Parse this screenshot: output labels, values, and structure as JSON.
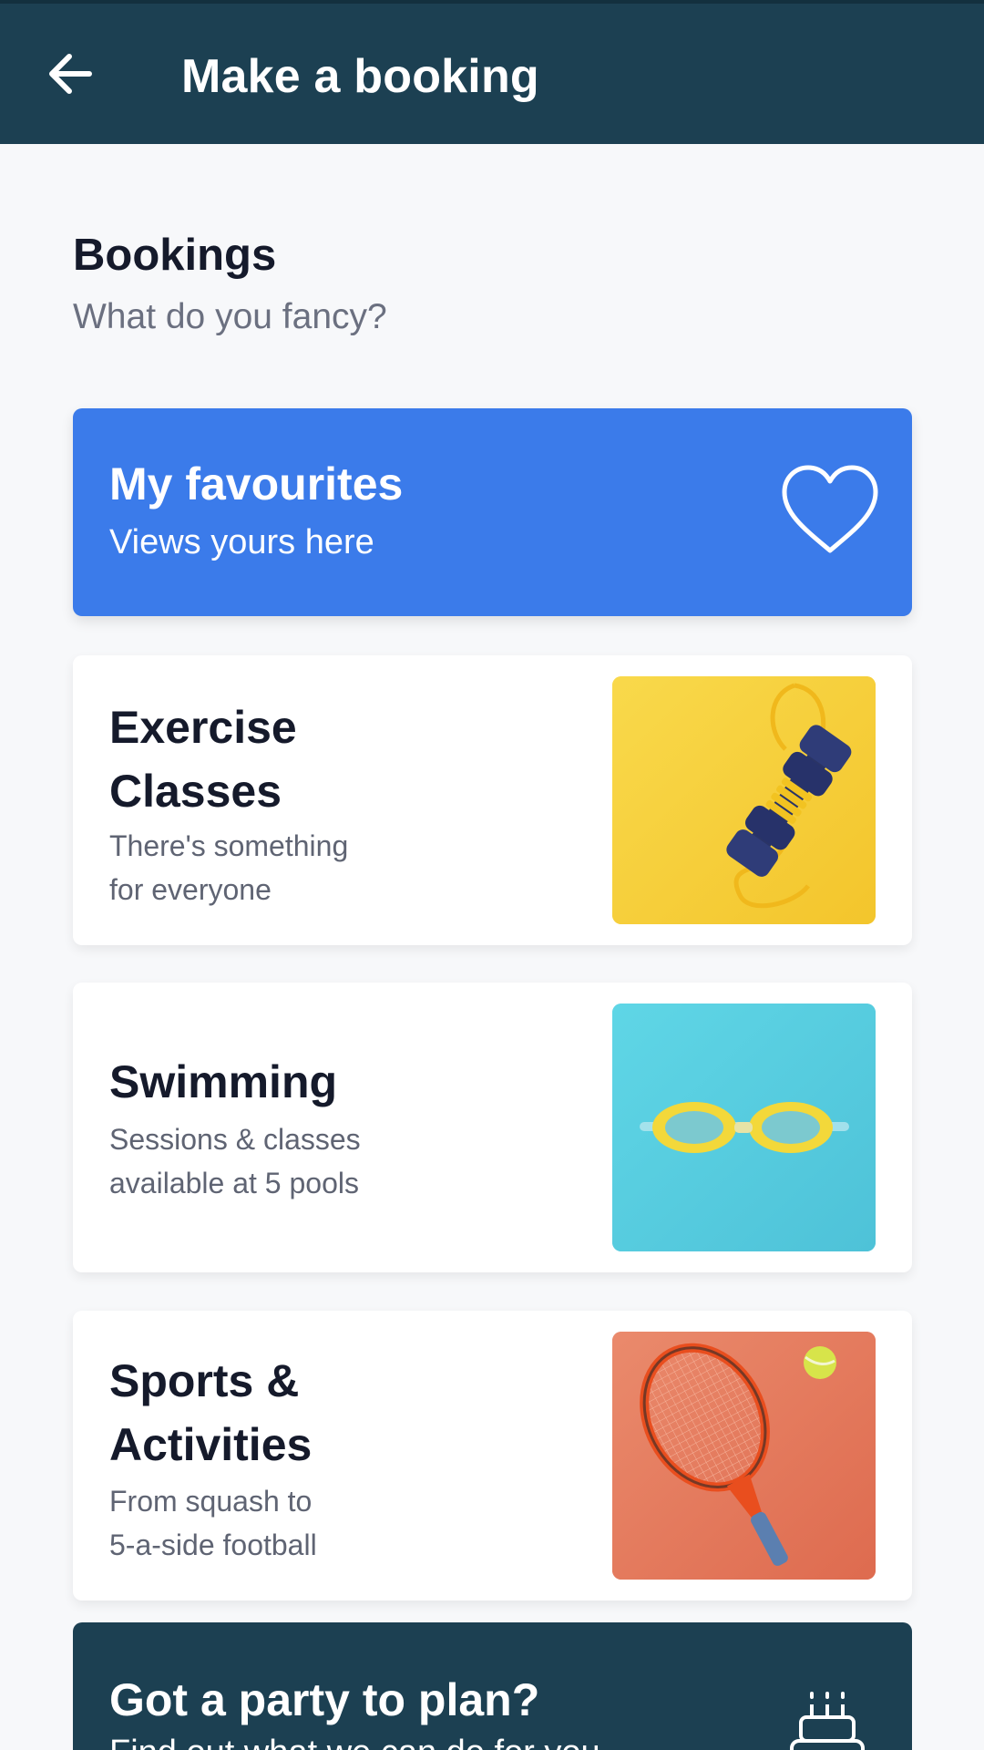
{
  "appbar": {
    "title": "Make a booking",
    "back_icon": "arrow-left-icon"
  },
  "section": {
    "title": "Bookings",
    "subtitle": "What do you fancy?"
  },
  "favourites": {
    "title": "My favourites",
    "subtitle": "Views yours here",
    "icon": "heart-icon",
    "color": "#3b7bea"
  },
  "cards": [
    {
      "title_line1": "Exercise",
      "title_line2": "Classes",
      "sub_line1": "There's something",
      "sub_line2": "for everyone",
      "image": "dumbbells-image",
      "image_bg": "#f7cf3d"
    },
    {
      "title_line1": "Swimming",
      "sub_line1": "Sessions & classes",
      "sub_line2": "available at 5 pools",
      "image": "swim-goggles-image",
      "image_bg": "#55c9de"
    },
    {
      "title_line1": "Sports &",
      "title_line2": "Activities",
      "sub_line1": "From squash to",
      "sub_line2": "5-a-side football",
      "image": "tennis-racket-image",
      "image_bg": "#e57a5e"
    }
  ],
  "party": {
    "title": "Got a party to plan?",
    "subtitle": "Find out what we can do for you",
    "icon": "cake-icon",
    "color": "#1c4052"
  },
  "colors": {
    "appbar": "#1c4052",
    "background": "#f7f8fa",
    "accent": "#3b7bea"
  }
}
